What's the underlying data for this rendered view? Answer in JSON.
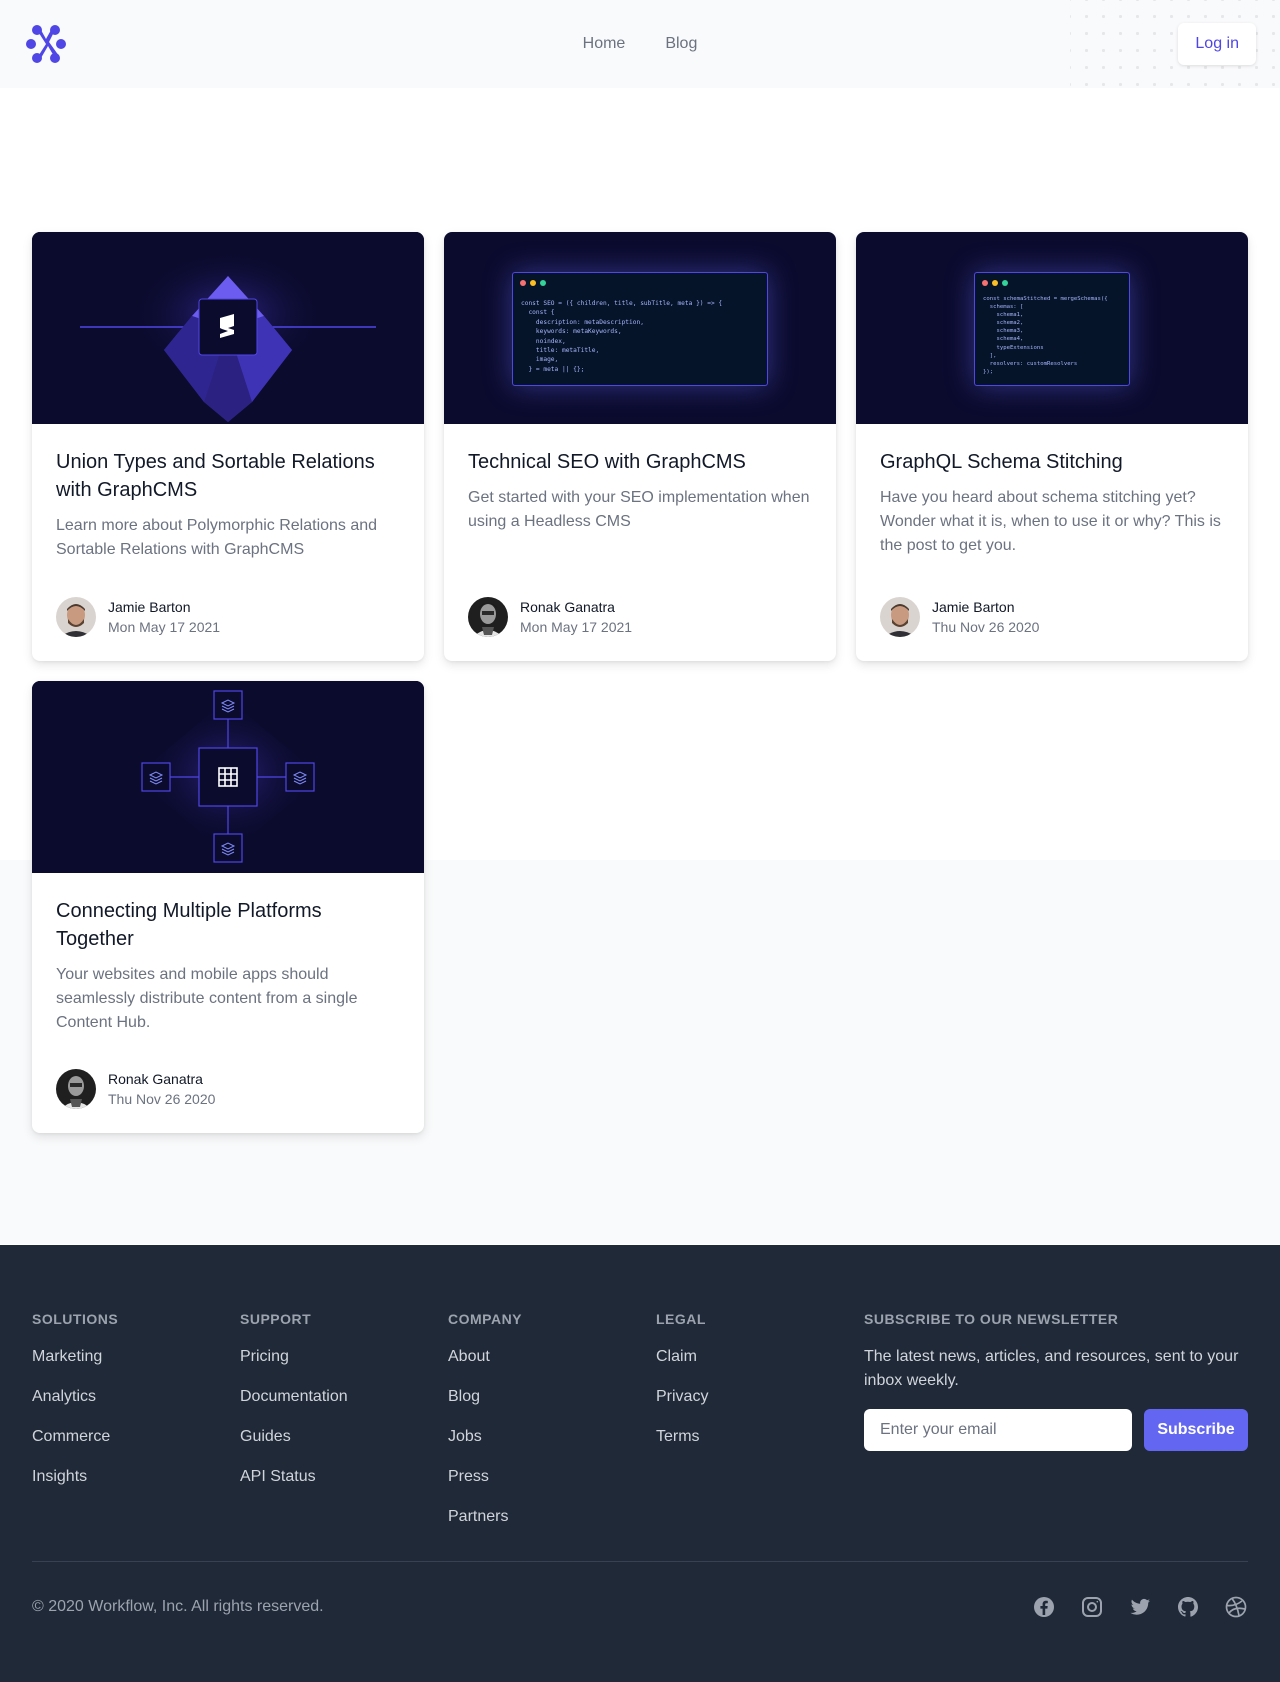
{
  "header": {
    "logo_icon": "workflow-logo-icon",
    "nav": [
      {
        "label": "Home"
      },
      {
        "label": "Blog"
      }
    ],
    "login_label": "Log in"
  },
  "posts": [
    {
      "title": "Union Types and Sortable Relations with GraphCMS",
      "description": "Learn more about Polymorphic Relations and Sortable Relations with GraphCMS",
      "author": "Jamie Barton",
      "date": "Mon May 17 2021",
      "image": "graphcms-iceberg-illustration"
    },
    {
      "title": "Technical SEO with GraphCMS",
      "description": "Get started with your SEO implementation when using a Headless CMS",
      "author": "Ronak Ganatra",
      "date": "Mon May 17 2021",
      "image": "seo-code-window-illustration"
    },
    {
      "title": "GraphQL Schema Stitching",
      "description": "Have you heard about schema stitching yet? Wonder what it is, when to use it or why? This is the post to get you.",
      "author": "Jamie Barton",
      "date": "Thu Nov 26 2020",
      "image": "schema-stitching-code-illustration"
    },
    {
      "title": "Connecting Multiple Platforms Together",
      "description": "Your websites and mobile apps should seamlessly distribute content from a single Content Hub.",
      "author": "Ronak Ganatra",
      "date": "Thu Nov 26 2020",
      "image": "content-hub-illustration"
    }
  ],
  "code_snippets": {
    "seo": [
      "const SEO = ({ children, title, subTitle, meta }) => {",
      "  const {",
      "    description: metaDescription,",
      "    keywords: metaKeywords,",
      "    noindex,",
      "    title: metaTitle,",
      "    image,",
      "  } = meta || {};"
    ],
    "stitching": [
      "const schemaStitched = mergeSchemas({",
      "  schemas: [",
      "    schema1,",
      "    schema2,",
      "    schema3,",
      "    schema4,",
      "    typeExtensions",
      "  ],",
      "  resolvers: customResolvers",
      "});"
    ]
  },
  "footer": {
    "columns": [
      {
        "heading": "Solutions",
        "links": [
          "Marketing",
          "Analytics",
          "Commerce",
          "Insights"
        ]
      },
      {
        "heading": "Support",
        "links": [
          "Pricing",
          "Documentation",
          "Guides",
          "API Status"
        ]
      },
      {
        "heading": "Company",
        "links": [
          "About",
          "Blog",
          "Jobs",
          "Press",
          "Partners"
        ]
      },
      {
        "heading": "Legal",
        "links": [
          "Claim",
          "Privacy",
          "Terms"
        ]
      }
    ],
    "newsletter": {
      "heading": "Subscribe to our newsletter",
      "text": "The latest news, articles, and resources, sent to your inbox weekly.",
      "placeholder": "Enter your email",
      "button": "Subscribe"
    },
    "copyright": "© 2020 Workflow, Inc. All rights reserved.",
    "socials": [
      "facebook-icon",
      "instagram-icon",
      "twitter-icon",
      "github-icon",
      "dribbble-icon"
    ]
  },
  "colors": {
    "accent": "#6366f1",
    "accent_dark": "#4f46e5",
    "footer_bg": "#1f2937",
    "card_image_bg": "#0b0b2e"
  }
}
